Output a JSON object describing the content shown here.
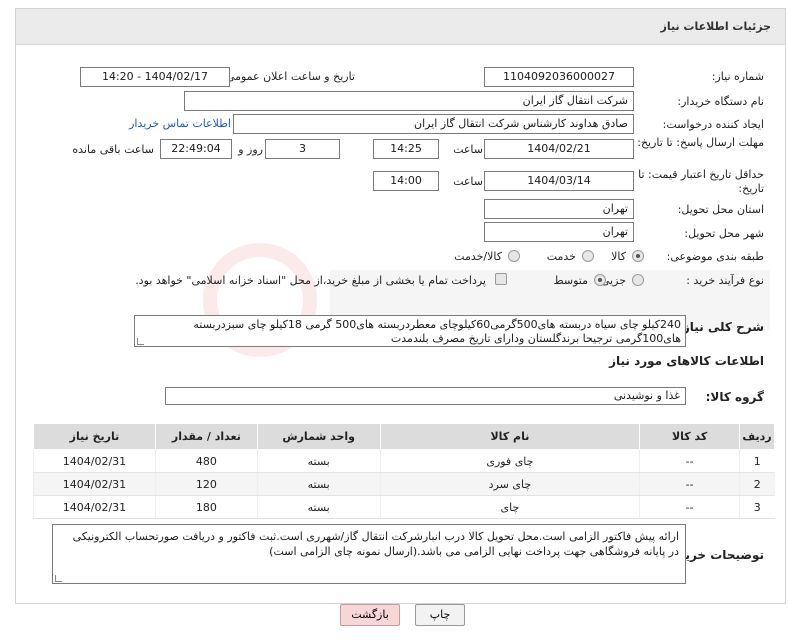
{
  "header": {
    "title": "جزئیات اطلاعات نیاز"
  },
  "need_number": {
    "label": "شماره نیاز:",
    "value": "1104092036000027"
  },
  "announce": {
    "label": "تاریخ و ساعت اعلان عمومی:",
    "value": "1404/02/17 - 14:20"
  },
  "buyer_org": {
    "label": "نام دستگاه خریدار:",
    "value": "شرکت انتقال گاز ایران"
  },
  "requester": {
    "label": "ایجاد کننده درخواست:",
    "value": "صادق  هداوند کارشناس شرکت انتقال گاز ایران",
    "contact_link": "اطلاعات تماس خریدار"
  },
  "reply_deadline": {
    "label": "مهلت ارسال پاسخ: تا تاریخ:",
    "date": "1404/02/21",
    "time_label": "ساعت",
    "time": "14:25",
    "days": "3",
    "days_label": "روز و",
    "remaining": "22:49:04",
    "remaining_label": "ساعت باقی مانده"
  },
  "price_validity": {
    "label": "حداقل تاریخ اعتبار قیمت: تا تاریخ:",
    "date": "1404/03/14",
    "time_label": "ساعت",
    "time": "14:00"
  },
  "province": {
    "label": "استان محل تحویل:",
    "value": "تهران"
  },
  "city": {
    "label": "شهر محل تحویل:",
    "value": "تهران"
  },
  "category": {
    "label": "طبقه بندی موضوعی:",
    "options": [
      "کالا",
      "خدمت",
      "کالا/خدمت"
    ]
  },
  "process": {
    "label": "نوع فرآیند خرید :",
    "options": [
      "جزیی",
      "متوسط"
    ],
    "note": "پرداخت تمام یا بخشی از مبلغ خرید،از محل \"اسناد خزانه اسلامی\" خواهد بود."
  },
  "description": {
    "label": "شرح کلی نیاز:",
    "value": "240کیلو چای سیاه دربسته های500گرمی60کیلوچای معطردربسته های500 گرمی 18کیلو چای سبزدربسته های100گرمی ترجیحا برندگلستان ودارای تاریخ مصرف بلندمدت"
  },
  "goods_info": {
    "title": "اطلاعات کالاهای مورد نیاز"
  },
  "goods_group": {
    "label": "گروه کالا:",
    "value": "غذا و نوشیدنی"
  },
  "table": {
    "headers": [
      "ردیف",
      "کد کالا",
      "نام کالا",
      "واحد شمارش",
      "تعداد / مقدار",
      "تاریخ نیاز"
    ],
    "rows": [
      {
        "row": "1",
        "code": "--",
        "name": "چای فوری",
        "unit": "بسته",
        "qty": "480",
        "date": "1404/02/31"
      },
      {
        "row": "2",
        "code": "--",
        "name": "چای سرد",
        "unit": "بسته",
        "qty": "120",
        "date": "1404/02/31"
      },
      {
        "row": "3",
        "code": "--",
        "name": "چای",
        "unit": "بسته",
        "qty": "180",
        "date": "1404/02/31"
      }
    ]
  },
  "buyer_notes": {
    "label": "توضیحات خریدار:",
    "value": "ارائه پیش فاکتور الزامی است.محل تحویل کالا درب انبارشرکت انتقال گاز/شهرری است.ثبت فاکتور و دریافت صورتحساب الکترونیکی در پایانه فروشگاهی جهت پرداخت نهایی الزامی می باشد.(ارسال نمونه چای الزامی است)"
  },
  "buttons": {
    "print": "چاپ",
    "back": "بازگشت"
  },
  "colors": {
    "link": "#1b5eb8",
    "back_button": "#f6d6d6"
  }
}
